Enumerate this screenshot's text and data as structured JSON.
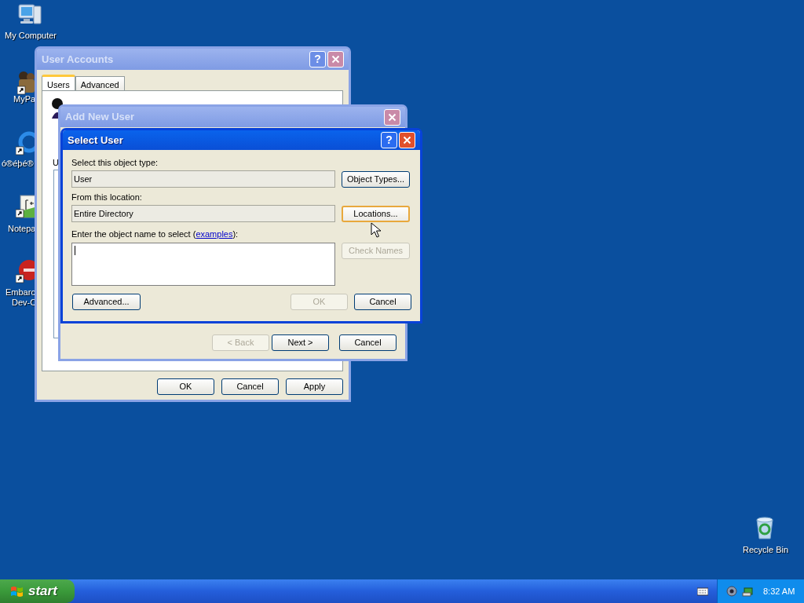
{
  "desktop_icons": [
    {
      "kind": "computer",
      "lines": [
        "My Computer"
      ]
    },
    {
      "kind": "photo",
      "lines": [
        "MyPa"
      ]
    },
    {
      "kind": "ring",
      "lines": [
        "ó®éþé®"
      ]
    },
    {
      "kind": "notepad",
      "lines": [
        "Notepa"
      ]
    },
    {
      "kind": "dev",
      "lines": [
        "Embarc",
        "Dev-C"
      ]
    },
    {
      "kind": "bin",
      "lines": [
        "Recycle Bin"
      ]
    }
  ],
  "user_accounts": {
    "title": "User Accounts",
    "active": false,
    "help": "?",
    "tabs": [
      {
        "label": "Users",
        "selected": true
      },
      {
        "label": "Advanced",
        "selected": false
      }
    ],
    "fragment": "U",
    "buttons": [
      {
        "label": "OK",
        "disabled": false
      },
      {
        "label": "Cancel",
        "disabled": false
      },
      {
        "label": "Apply",
        "disabled": false
      }
    ]
  },
  "add_new_user": {
    "title": "Add New User",
    "active": false,
    "buttons": [
      {
        "label": "< Back",
        "disabled": true
      },
      {
        "label": "Next >",
        "disabled": false
      },
      {
        "label": "Cancel",
        "disabled": false
      }
    ]
  },
  "select_user": {
    "title": "Select User",
    "active": true,
    "help": "?",
    "fields": [
      {
        "label": "Select this object type:",
        "value": "User",
        "button": {
          "label": "Object Types...",
          "disabled": false,
          "focused": false
        }
      },
      {
        "label": "From this location:",
        "value": "Entire Directory",
        "button": {
          "label": "Locations...",
          "disabled": false,
          "focused": true
        }
      }
    ],
    "entry": {
      "label_before": "Enter the object name to select (",
      "link": "examples",
      "label_after": "):",
      "button": {
        "label": "Check Names",
        "disabled": true
      }
    },
    "advanced": {
      "label": "Advanced...",
      "disabled": false
    },
    "buttons": [
      {
        "label": "OK",
        "disabled": true
      },
      {
        "label": "Cancel",
        "disabled": false
      }
    ]
  },
  "taskbar": {
    "start": "start",
    "clock": "8:32 AM"
  }
}
